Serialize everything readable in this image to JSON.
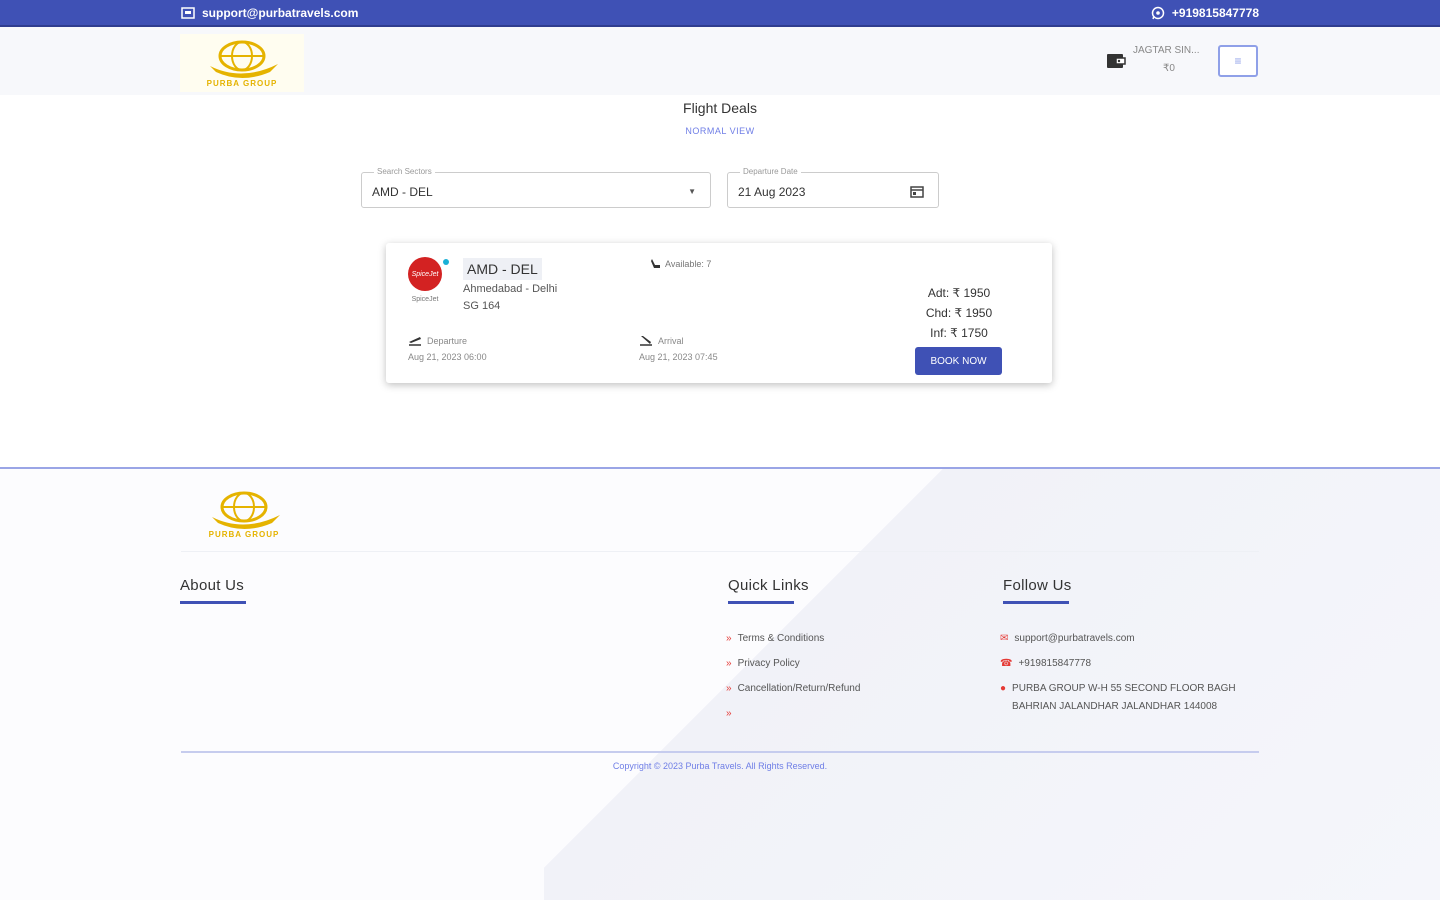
{
  "topbar": {
    "email": "support@purbatravels.com",
    "phone": "+919815847778"
  },
  "header": {
    "logo_text": "PURBA GROUP",
    "user_name": "JAGTAR SIN...",
    "balance": "₹0",
    "menu_icon": "≡"
  },
  "page": {
    "title": "Flight Deals",
    "view_link": "NORMAL VIEW"
  },
  "search": {
    "sector_label": "Search Sectors",
    "sector_value": "AMD - DEL",
    "date_label": "Departure Date",
    "date_value": "21 Aug 2023"
  },
  "flight": {
    "airline": "SpiceJet",
    "sector": "AMD - DEL",
    "route": "Ahmedabad - Delhi",
    "flight_no": "SG 164",
    "available": "Available: 7",
    "departure_label": "Departure",
    "departure_time": "Aug 21, 2023 06:00",
    "arrival_label": "Arrival",
    "arrival_time": "Aug 21, 2023 07:45",
    "adult_fare": "Adt: ₹ 1950",
    "child_fare": "Chd: ₹ 1950",
    "infant_fare": "Inf: ₹ 1750",
    "book_label": "BOOK NOW"
  },
  "footer": {
    "logo_text": "PURBA GROUP",
    "about_heading": "About Us",
    "quick_links_heading": "Quick Links",
    "quick_links": [
      "Terms & Conditions",
      "Privacy Policy",
      "Cancellation/Return/Refund",
      ""
    ],
    "follow_heading": "Follow Us",
    "contact_email": "support@purbatravels.com",
    "contact_phone": "+919815847778",
    "address_line1": "PURBA GROUP W-H 55 SECOND FLOOR BAGH",
    "address_line2": "BAHRIAN JALANDHAR JALANDHAR 144008",
    "copyright": "Copyright © 2023 Purba Travels. All Rights Reserved."
  },
  "colors": {
    "primary": "#3f51b5",
    "accent_link": "#6f7ee6",
    "logo_gold": "#e5b300",
    "icon_red": "#e53935"
  }
}
